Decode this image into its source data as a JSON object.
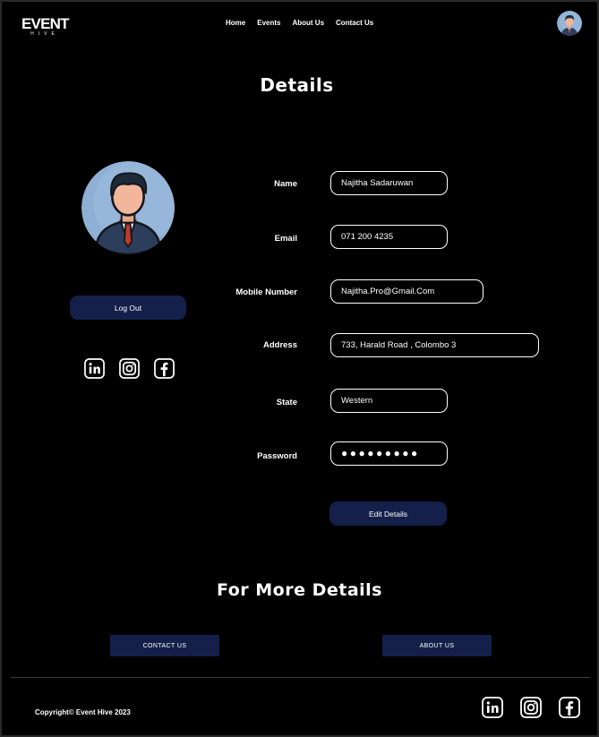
{
  "header": {
    "logo_main": "EVENT",
    "logo_sub": "HIVE",
    "nav": [
      "Home",
      "Events",
      "About Us",
      "Contact Us"
    ]
  },
  "details_title": "Details",
  "profile": {
    "logout_label": "Log Out"
  },
  "form": {
    "name_label": "Name",
    "name_value": "Najitha Sadaruwan",
    "email_label": "Email",
    "email_value": "071 200 4235",
    "mobile_label": "Mobile Number",
    "mobile_value": "Najitha.Pro@Gmail.Com",
    "address_label": "Address",
    "address_value": "733, Harald Road , Colombo 3",
    "state_label": "State",
    "state_value": "Western",
    "password_label": "Password",
    "password_value": "●●●●●●●●●",
    "edit_label": "Edit Details"
  },
  "more_title": "For More Details",
  "contact_label": "CONTACT US",
  "about_label": "ABOUT US",
  "footer": {
    "copyright": "Copyright© Event Hive 2023"
  },
  "social_icons": [
    "linkedin-icon",
    "instagram-icon",
    "facebook-icon"
  ],
  "colors": {
    "background": "#000000",
    "button": "#14204a",
    "avatar_bg": "#8fb0d4"
  }
}
